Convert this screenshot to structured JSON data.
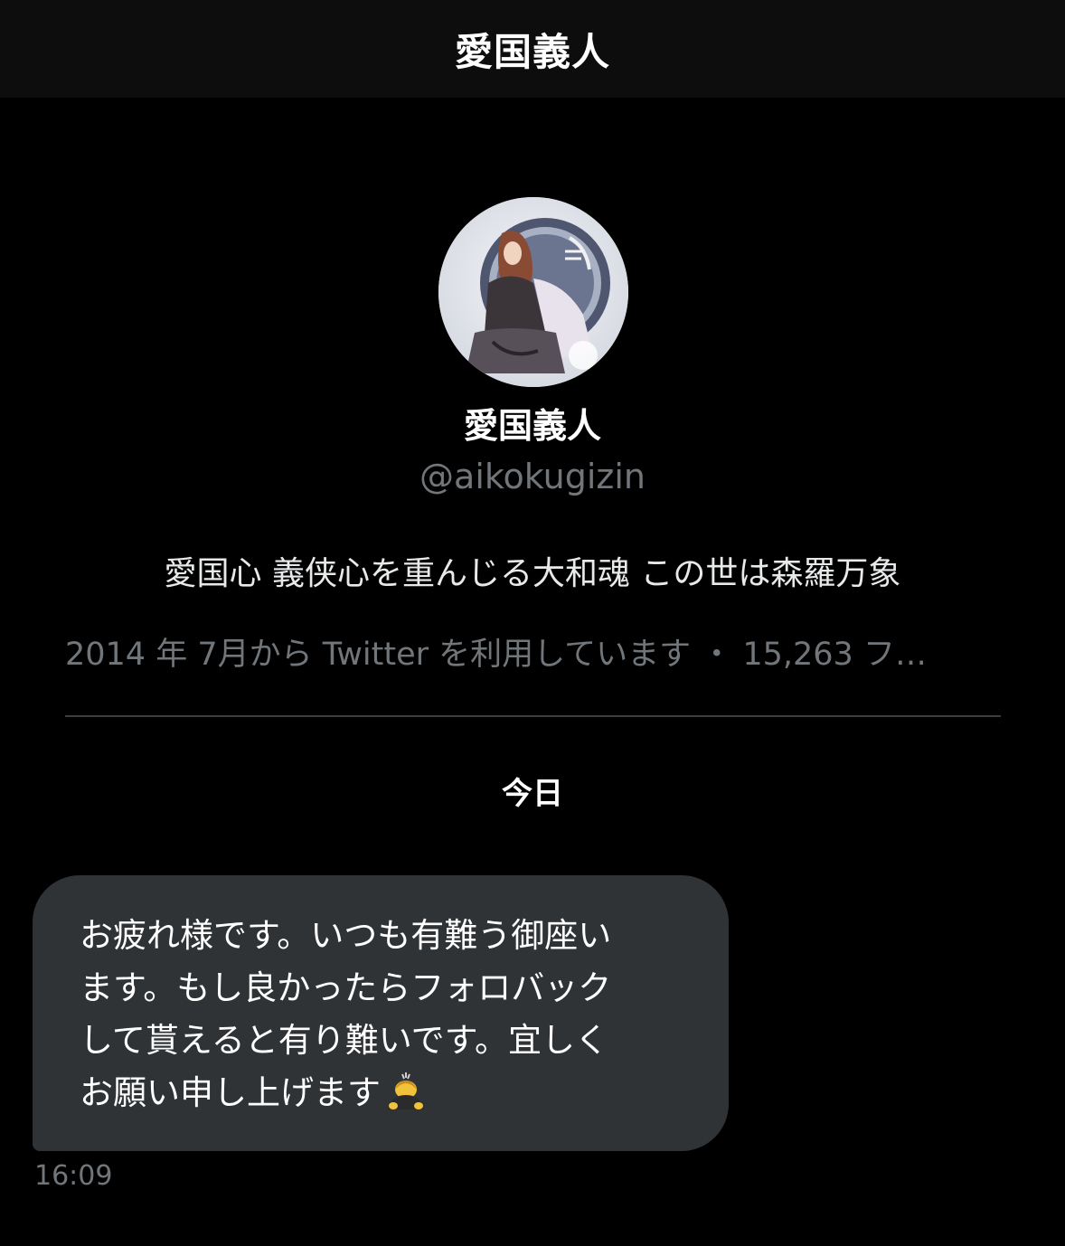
{
  "header": {
    "title": "愛国義人"
  },
  "profile": {
    "name": "愛国義人",
    "handle": "@aikokugizin",
    "bio": "愛国心 義侠心を重んじる大和魂 この世は森羅万象",
    "meta": "2014 年 7月から Twitter を利用しています ・ 15,263 フ…"
  },
  "conversation": {
    "date_separator": "今日",
    "messages": [
      {
        "lines": [
          "お疲れ様です。いつも有難う御座い",
          "ます。もし良かったらフォロバック",
          "して貰えると有り難いです。宜しく",
          "お願い申し上げます"
        ],
        "emoji_icon": "bowing-person-icon",
        "time": "16:09"
      }
    ]
  }
}
